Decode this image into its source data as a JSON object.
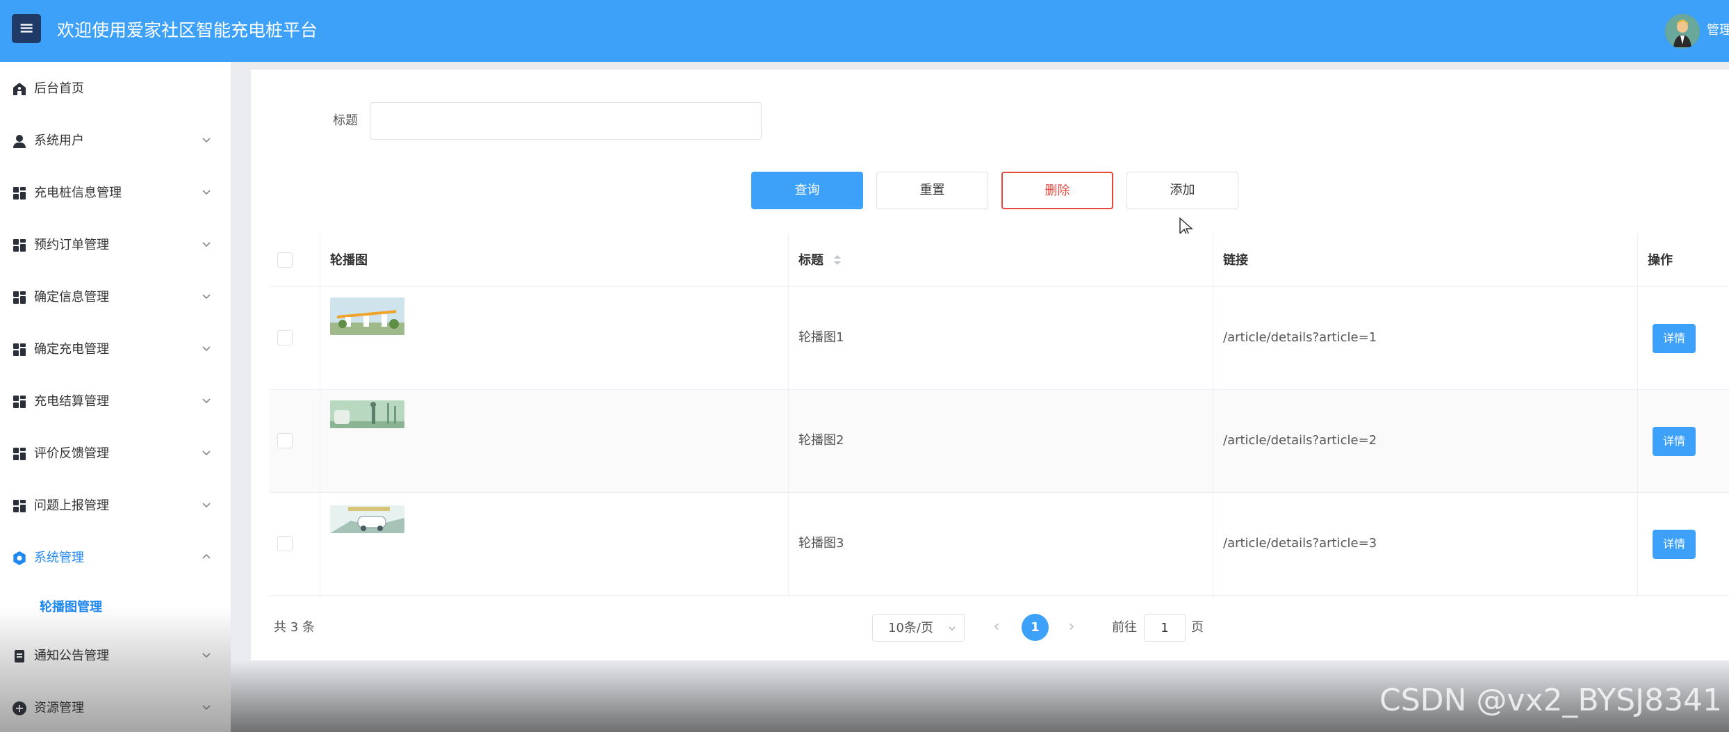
{
  "header": {
    "menu_icon": "hamburger-icon",
    "title": "欢迎使用爱家社区智能充电桩平台",
    "user_name": "管理员",
    "avatar_icon": "user-avatar-icon",
    "colors": {
      "primary": "#3da1f9",
      "menu_button": "#1f3a66"
    }
  },
  "sidebar": {
    "items": [
      {
        "label": "后台首页",
        "icon": "home-icon"
      },
      {
        "label": "系统用户",
        "icon": "user-icon"
      },
      {
        "label": "充电桩信息管理",
        "icon": "grid-icon"
      },
      {
        "label": "预约订单管理",
        "icon": "grid-icon"
      },
      {
        "label": "确定信息管理",
        "icon": "grid-icon"
      },
      {
        "label": "确定充电管理",
        "icon": "grid-icon"
      },
      {
        "label": "充电结算管理",
        "icon": "grid-icon"
      },
      {
        "label": "评价反馈管理",
        "icon": "grid-icon"
      },
      {
        "label": "问题上报管理",
        "icon": "grid-icon"
      },
      {
        "label": "系统管理",
        "icon": "gear-icon",
        "expanded": true
      },
      {
        "label": "轮播图管理",
        "sub": true,
        "active": true
      },
      {
        "label": "通知公告管理",
        "icon": "document-icon"
      },
      {
        "label": "资源管理",
        "icon": "plus-circle-icon"
      }
    ]
  },
  "search": {
    "label": "标题",
    "value": "",
    "placeholder": ""
  },
  "actions": {
    "query": "查询",
    "reset": "重置",
    "delete": "删除",
    "add": "添加"
  },
  "table": {
    "columns": [
      "轮播图",
      "标题",
      "链接",
      "操作"
    ],
    "rows": [
      {
        "title": "轮播图1",
        "link": "/article/details?article=1",
        "action": "详情"
      },
      {
        "title": "轮播图2",
        "link": "/article/details?article=2",
        "action": "详情"
      },
      {
        "title": "轮播图3",
        "link": "/article/details?article=3",
        "action": "详情"
      }
    ]
  },
  "pagination": {
    "total": "共 3 条",
    "page_size": "10条/页",
    "current_page": "1",
    "goto_label": "前往",
    "goto_value": "1",
    "goto_suffix": "页"
  },
  "watermark": "CSDN @vx2_BYSJ8341"
}
